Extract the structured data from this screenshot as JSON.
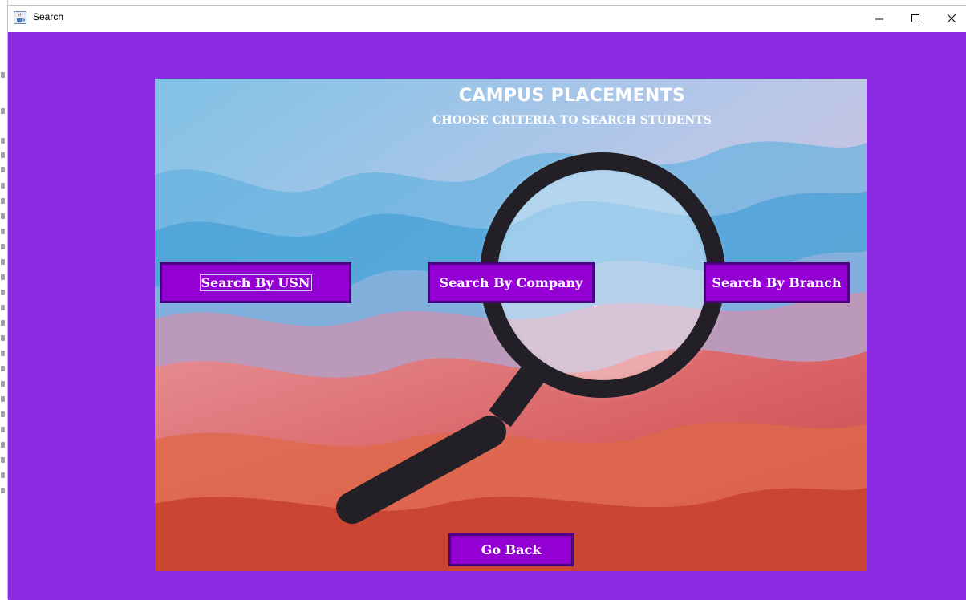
{
  "window": {
    "title": "Search",
    "app_icon": "java-cup-icon",
    "controls": [
      "minimize-icon",
      "maximize-icon",
      "close-icon"
    ]
  },
  "colors": {
    "content_background": "#8a2be2",
    "button_background": "#9400d3",
    "button_border": "#4b0082",
    "text": "#ffffff"
  },
  "poster": {
    "title": "CAMPUS PLACEMENTS",
    "subtitle": "CHOOSE CRITERIA TO SEARCH STUDENTS",
    "illustration": "magnifying-glass-icon"
  },
  "buttons": {
    "usn": "Search By USN",
    "company": "Search By Company",
    "branch": "Search By Branch",
    "back": "Go Back"
  }
}
